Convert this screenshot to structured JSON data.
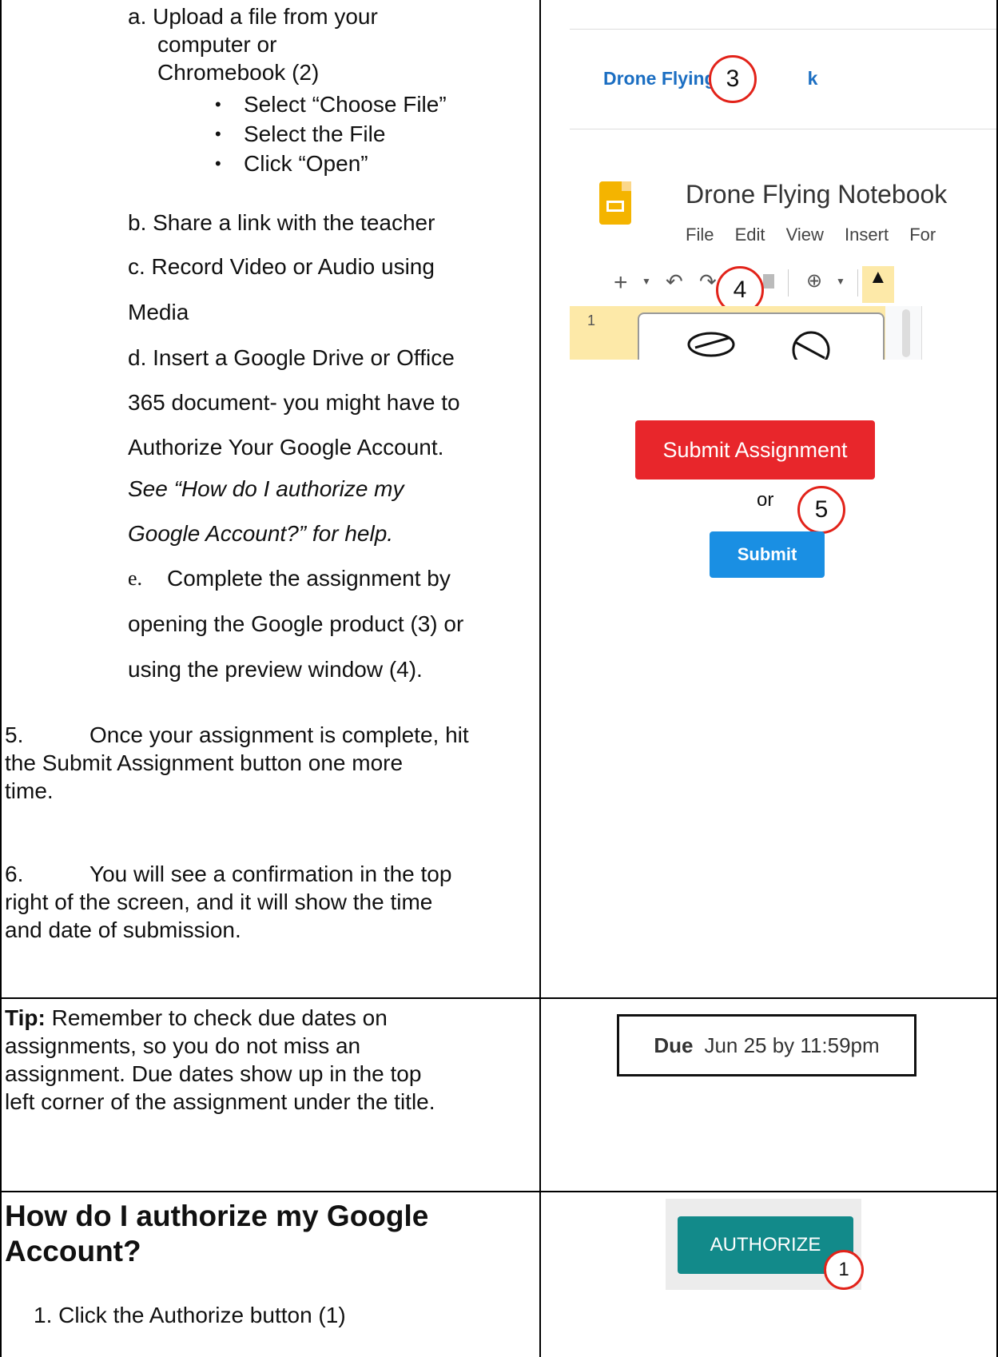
{
  "left_col": {
    "step_a": "a.  Upload a file from your",
    "step_a_2": "computer or",
    "step_a_3": "Chromebook (2)",
    "bullets": [
      "Select “Choose File”",
      "Select the File",
      "Click “Open”"
    ],
    "step_b": "b.  Share a link with the teacher",
    "step_c": "c.  Record Video or Audio using",
    "step_c_2": "Media",
    "step_d": "d.  Insert a Google Drive or Office",
    "step_d_2": "365 document- you might have to",
    "step_d_3": "Authorize Your Google Account.",
    "step_d_4": "See “How do I authorize my",
    "step_d_5": "Google Account?” for help.",
    "step_e_letter": "e.",
    "step_e": "Complete the assignment by",
    "step_e_2": "opening the Google product (3) or",
    "step_e_3": "using the preview window (4).",
    "step5_num": "5.",
    "step5": "Once your assignment is complete, hit",
    "step5_2": "the Submit Assignment button one more",
    "step5_3": "time.",
    "step6_num": "6.",
    "step6": "You will see a confirmation in the top",
    "step6_2": "right of the screen, and it will show the time",
    "step6_3": "and date of submission."
  },
  "tip": {
    "label": "Tip:",
    "line1": " Remember to check due dates on",
    "line2": "assignments, so you do not miss an",
    "line3": "assignment. Due dates show up in the top",
    "line4": "left corner of the assignment under the title."
  },
  "authorize_section": {
    "heading1": "How do I authorize my Google",
    "heading2": "Account?",
    "step1": "1.  Click the Authorize button (1)"
  },
  "screens": {
    "drone_link": "Drone Flying No",
    "drone_link_tail": "k",
    "doc_title": "Drone Flying Notebook",
    "menu": [
      "File",
      "Edit",
      "View",
      "Insert",
      "For"
    ],
    "slide_num": "1",
    "submit_assignment": "Submit Assignment",
    "or": "or",
    "submit": "Submit",
    "due_label": "Due",
    "due_value": "Jun 25 by 11:59pm",
    "authorize_btn": "AUTHORIZE",
    "markers": [
      "3",
      "4",
      "5",
      "1"
    ]
  },
  "colors": {
    "marker_red": "#e2231a",
    "submit_red": "#e8262b",
    "submit_blue": "#1a8fe3",
    "authorize_teal": "#128a8a",
    "link_blue": "#1b6ec2",
    "slides_yellow": "#f4b400"
  }
}
